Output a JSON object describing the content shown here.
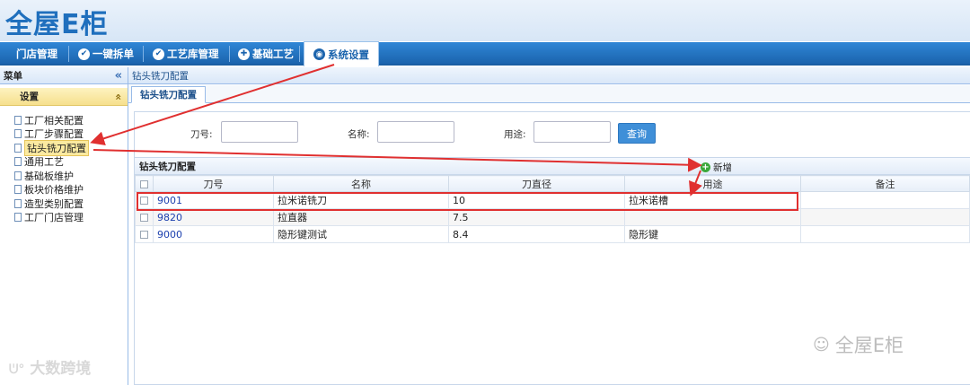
{
  "app": {
    "logo_text": "全屋E柜"
  },
  "nav": {
    "items": [
      {
        "label": "门店管理",
        "icon": ""
      },
      {
        "label": "一键拆单",
        "icon": "check-circle-icon"
      },
      {
        "label": "工艺库管理",
        "icon": "check-circle-icon"
      },
      {
        "label": "基础工艺",
        "icon": "gear-circle-icon"
      },
      {
        "label": "系统设置",
        "icon": "settings-circle-icon",
        "active": true
      }
    ]
  },
  "sidebar": {
    "title": "菜单",
    "collapse_glyph": "«",
    "group": {
      "label": "设置",
      "toggle_glyph": "«"
    },
    "items": [
      {
        "label": "工厂相关配置"
      },
      {
        "label": "工厂步骤配置"
      },
      {
        "label": "钻头铣刀配置",
        "selected": true
      },
      {
        "label": "通用工艺"
      },
      {
        "label": "基础板维护"
      },
      {
        "label": "板块价格维护"
      },
      {
        "label": "造型类别配置"
      },
      {
        "label": "工厂门店管理"
      }
    ]
  },
  "breadcrumb": "钻头铣刀配置",
  "tab": {
    "label": "钻头铣刀配置"
  },
  "filters": {
    "knife_label": "刀号:",
    "knife_value": "",
    "name_label": "名称:",
    "name_value": "",
    "usage_label": "用途:",
    "usage_value": "",
    "query_button": "查询"
  },
  "grid": {
    "title": "钻头铣刀配置",
    "add_button": "新增",
    "columns": [
      "刀号",
      "名称",
      "刀直径",
      "用途",
      "备注"
    ],
    "rows": [
      {
        "id": "9001",
        "name": "拉米诺铣刀",
        "diameter": "10",
        "usage": "拉米诺槽",
        "remark": ""
      },
      {
        "id": "9820",
        "name": "拉直器",
        "diameter": "7.5",
        "usage": "",
        "remark": ""
      },
      {
        "id": "9000",
        "name": "隐形键测试",
        "diameter": "8.4",
        "usage": "隐形键",
        "remark": ""
      }
    ]
  },
  "watermarks": {
    "left": "大数跨境",
    "right": "全屋E柜"
  },
  "colors": {
    "nav_bg": "#1b64ad",
    "annotation_red": "#e03030",
    "selected_bg": "#fbeaa0"
  }
}
